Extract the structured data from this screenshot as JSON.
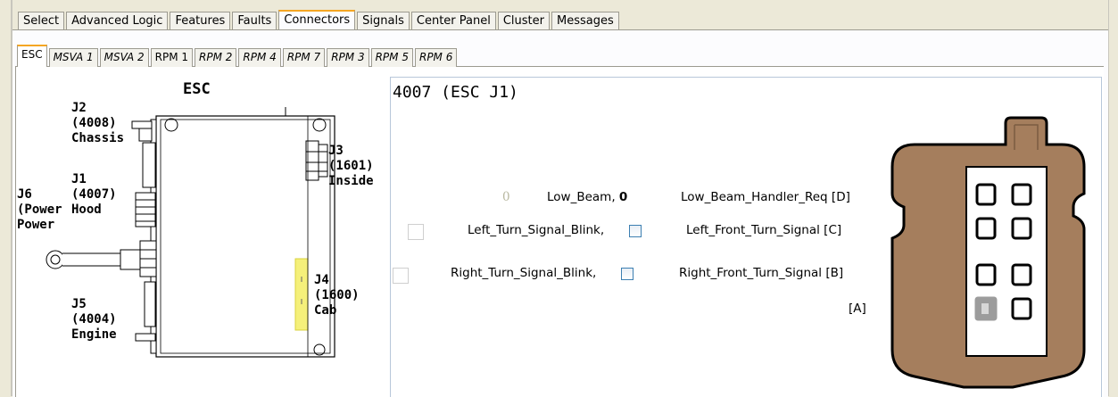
{
  "main_tabs": [
    "Select",
    "Advanced Logic",
    "Features",
    "Faults",
    "Connectors",
    "Signals",
    "Center Panel",
    "Cluster",
    "Messages"
  ],
  "main_tab_active": "Connectors",
  "sub_tabs": [
    "ESC",
    "MSVA 1",
    "MSVA 2",
    "RPM 1",
    "RPM 2",
    "RPM 4",
    "RPM 7",
    "RPM 3",
    "RPM 5",
    "RPM 6"
  ],
  "sub_tab_active": "ESC",
  "diagram": {
    "title": "ESC",
    "j2": "J2\n(4008)\nChassis",
    "j1": "J1\n(4007)",
    "hood": "Hood",
    "j6": "J6",
    "power_label": "(Power",
    "power2": "Power",
    "j3": "J3\n(1601)\nInside",
    "j4": "J4\n(1600)\nCab",
    "j5": "J5\n(4004)\nEngine"
  },
  "connector_title": "4007 (ESC J1)",
  "signals": [
    {
      "value": "0",
      "name": "Low_Beam,",
      "bold_value": "0",
      "pin_label": "Low_Beam_Handler_Req [D]"
    },
    {
      "name": "Left_Turn_Signal_Blink,",
      "pin_label": "Left_Front_Turn_Signal [C]"
    },
    {
      "name": "Right_Turn_Signal_Blink,",
      "pin_label": "Right_Front_Turn_Signal [B]"
    },
    {
      "pin_label": "[A]"
    }
  ],
  "colors": {
    "connector_body": "#a57e5d",
    "connector_outline": "#000000",
    "highlight": "#f5f07a",
    "active_tab_accent": "#f5a623",
    "checkbox_border": "#3c7fb1"
  }
}
